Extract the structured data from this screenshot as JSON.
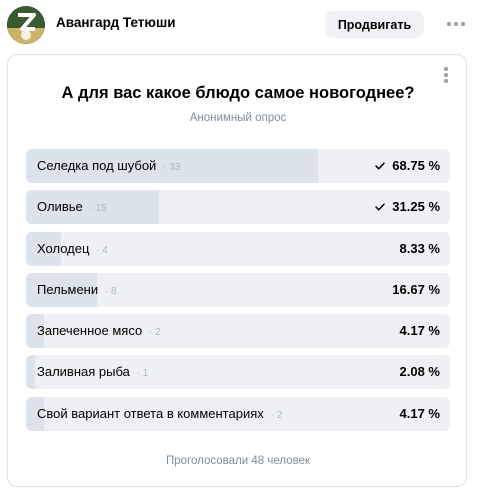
{
  "header": {
    "author": "Авангард Тетюши",
    "promote_label": "Продвигать",
    "avatar_icon": "community-logo-icon",
    "more_icon": "more-horizontal-icon"
  },
  "poll": {
    "title": "А для вас какое блюдо самое новогоднее?",
    "subtitle": "Анонимный опрос",
    "footer": "Проголосовали 48 человек",
    "menu_icon": "more-vertical-icon",
    "options": [
      {
        "label": "Селедка под шубой",
        "count": "33",
        "percent": "68.75 %",
        "share": 0.6875,
        "voted": true
      },
      {
        "label": "Оливье",
        "count": "15",
        "percent": "31.25 %",
        "share": 0.3125,
        "voted": true
      },
      {
        "label": "Холодец",
        "count": "4",
        "percent": "8.33 %",
        "share": 0.0833,
        "voted": false
      },
      {
        "label": "Пельмени",
        "count": "8",
        "percent": "16.67 %",
        "share": 0.1667,
        "voted": false
      },
      {
        "label": "Запеченное мясо",
        "count": "2",
        "percent": "4.17 %",
        "share": 0.0417,
        "voted": false
      },
      {
        "label": "Заливная рыба",
        "count": "1",
        "percent": "2.08 %",
        "share": 0.0208,
        "voted": false
      },
      {
        "label": "Свой вариант ответа в комментариях",
        "count": "2",
        "percent": "4.17 %",
        "share": 0.0417,
        "voted": false
      }
    ]
  }
}
